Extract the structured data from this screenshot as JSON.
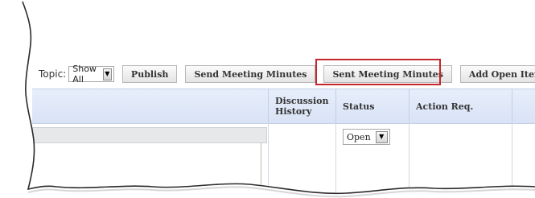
{
  "toolbar": {
    "topic_label": "Topic:",
    "topic_value": "Show All",
    "publish": "Publish",
    "send_minutes": "Send Meeting Minutes",
    "sent_minutes": "Sent Meeting Minutes",
    "add_open_items": "Add Open Items"
  },
  "table": {
    "headers": {
      "discussion_history": "Discussion History",
      "status": "Status",
      "action_req": "Action Req."
    },
    "row": {
      "status_value": "Open"
    }
  },
  "colors": {
    "highlight": "#c4262b",
    "header_bg": "#dce5f7"
  }
}
